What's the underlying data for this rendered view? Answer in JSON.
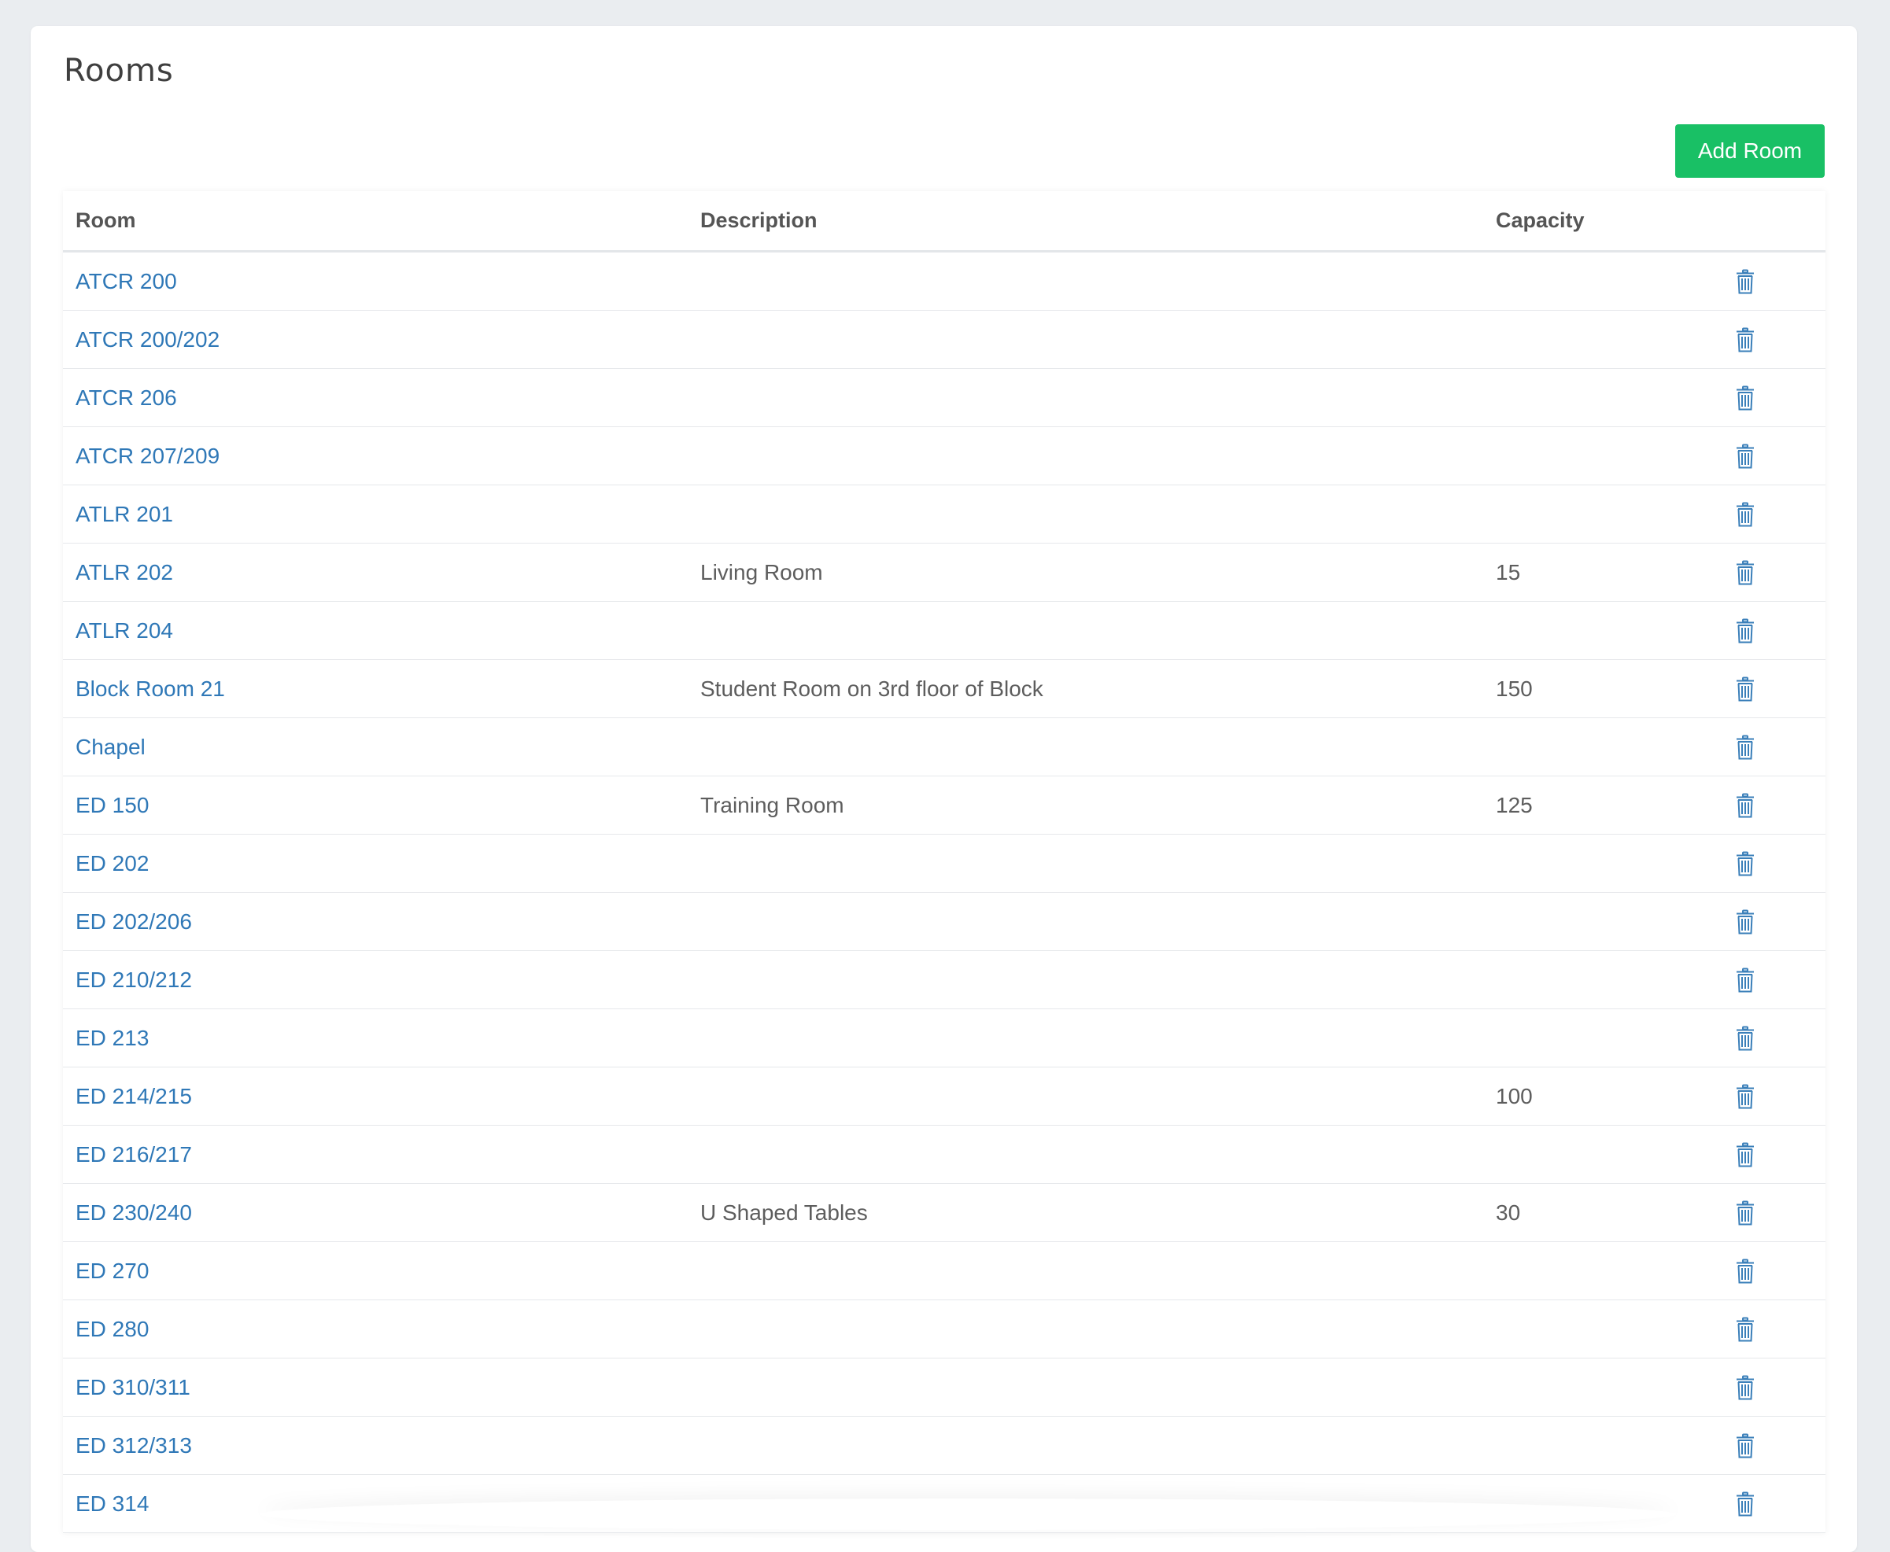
{
  "page": {
    "title": "Rooms",
    "add_button_label": "Add Room"
  },
  "table": {
    "columns": [
      "Room",
      "Description",
      "Capacity",
      ""
    ],
    "rows": [
      {
        "room": "ATCR 200",
        "description": "",
        "capacity": ""
      },
      {
        "room": "ATCR 200/202",
        "description": "",
        "capacity": ""
      },
      {
        "room": "ATCR 206",
        "description": "",
        "capacity": ""
      },
      {
        "room": "ATCR 207/209",
        "description": "",
        "capacity": ""
      },
      {
        "room": "ATLR 201",
        "description": "",
        "capacity": ""
      },
      {
        "room": "ATLR 202",
        "description": "Living Room",
        "capacity": "15"
      },
      {
        "room": "ATLR 204",
        "description": "",
        "capacity": ""
      },
      {
        "room": "Block Room 21",
        "description": "Student Room on 3rd floor of Block",
        "capacity": "150"
      },
      {
        "room": "Chapel",
        "description": "",
        "capacity": ""
      },
      {
        "room": "ED 150",
        "description": "Training Room",
        "capacity": "125"
      },
      {
        "room": "ED 202",
        "description": "",
        "capacity": ""
      },
      {
        "room": "ED 202/206",
        "description": "",
        "capacity": ""
      },
      {
        "room": "ED 210/212",
        "description": "",
        "capacity": ""
      },
      {
        "room": "ED 213",
        "description": "",
        "capacity": ""
      },
      {
        "room": "ED 214/215",
        "description": "",
        "capacity": "100"
      },
      {
        "room": "ED 216/217",
        "description": "",
        "capacity": ""
      },
      {
        "room": "ED 230/240",
        "description": "U Shaped Tables",
        "capacity": "30"
      },
      {
        "room": "ED 270",
        "description": "",
        "capacity": ""
      },
      {
        "room": "ED 280",
        "description": "",
        "capacity": ""
      },
      {
        "room": "ED 310/311",
        "description": "",
        "capacity": ""
      },
      {
        "room": "ED 312/313",
        "description": "",
        "capacity": ""
      },
      {
        "room": "ED 314",
        "description": "",
        "capacity": ""
      }
    ]
  },
  "icons": {
    "row_action": "trash-icon"
  },
  "colors": {
    "page_background": "#eaedf0",
    "accent_green": "#19c065",
    "link_blue": "#2f78b7",
    "icon_blue": "#3a7fb9"
  }
}
